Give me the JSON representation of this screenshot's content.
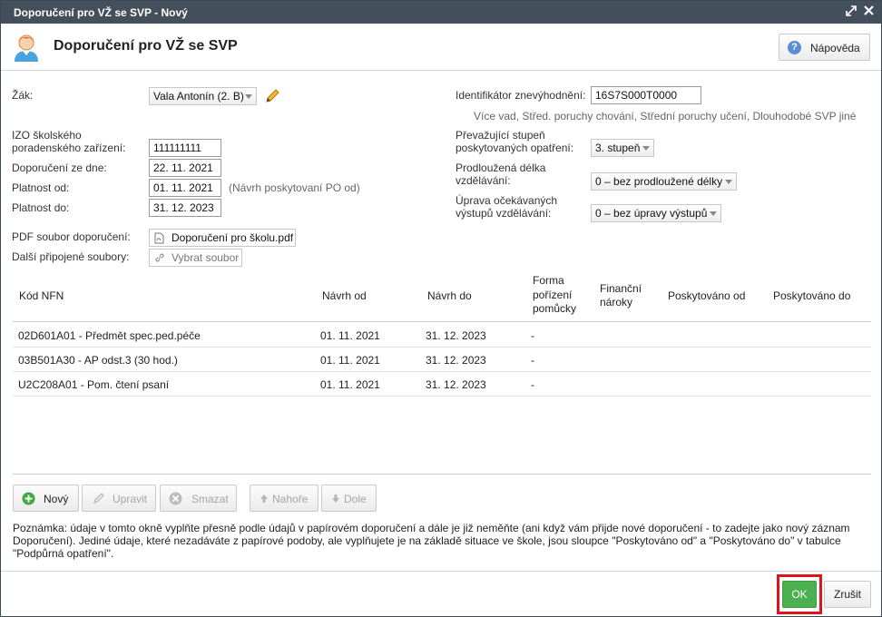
{
  "window": {
    "title": "Doporučení pro VŽ se SVP - Nový"
  },
  "header": {
    "title": "Doporučení pro VŽ se SVP",
    "help_label": "Nápověda"
  },
  "form": {
    "zak_label": "Žák:",
    "zak_value": "Vala Antonín (2. B)",
    "izo_label_1": "IZO školského",
    "izo_label_2": "poradenského zařízení:",
    "izo_value": "111111111",
    "doporuceni_label": "Doporučení ze dne:",
    "doporuceni_value": "22. 11. 2021",
    "platnost_od_label": "Platnost od:",
    "platnost_od_value": "01. 11. 2021",
    "platnost_od_note": "(Návrh poskytovaní PO od)",
    "platnost_do_label": "Platnost do:",
    "platnost_do_value": "31. 12. 2023",
    "pdf_label": "PDF soubor doporučení:",
    "pdf_value": "Doporučení pro školu.pdf",
    "dalsi_label": "Další připojené soubory:",
    "dalsi_value": "Vybrat soubor",
    "ident_label": "Identifikátor znevýhodnění:",
    "ident_value": "16S7S000T0000",
    "ident_desc": "Více vad, Střed. poruchy chování, Střední poruchy učení, Dlouhodobé SVP jiné",
    "stupen_label_1": "Převažující stupeň",
    "stupen_label_2": "poskytovaných opatření:",
    "stupen_value": "3. stupeň",
    "delka_label_1": "Prodloužená délka",
    "delka_label_2": "vzdělávání:",
    "delka_value": "0 – bez prodloužené délky",
    "uprava_label_1": "Úprava očekávaných",
    "uprava_label_2": "výstupů vzdělávání:",
    "uprava_value": "0 – bez úpravy výstupů"
  },
  "table": {
    "headers": {
      "kod": "Kód NFN",
      "navrh_od": "Návrh od",
      "navrh_do": "Návrh do",
      "forma_1": "Forma",
      "forma_2": "pořízení",
      "forma_3": "pomůcky",
      "financni_1": "Finanční",
      "financni_2": "nároky",
      "posk_od": "Poskytováno od",
      "posk_do": "Poskytováno do"
    },
    "rows": [
      {
        "kod": "02D601A01 - Předmět spec.ped.péče",
        "navrh_od": "01. 11. 2021",
        "navrh_do": "31. 12. 2023",
        "forma": "-"
      },
      {
        "kod": "03B501A30 - AP odst.3 (30 hod.)",
        "navrh_od": "01. 11. 2021",
        "navrh_do": "31. 12. 2023",
        "forma": "-"
      },
      {
        "kod": "U2C208A01 - Pom. čtení psaní",
        "navrh_od": "01. 11. 2021",
        "navrh_do": "31. 12. 2023",
        "forma": "-"
      }
    ]
  },
  "toolbar": {
    "novy": "Nový",
    "upravit": "Upravit",
    "smazat": "Smazat",
    "nahore": "Nahoře",
    "dole": "Dole"
  },
  "note": "Poznámka: údaje v tomto okně vyplňte přesně podle údajů v papírovém doporučení a dále je již neměňte (ani když vám přijde nové doporučení - to zadejte jako nový záznam Doporučení). Jediné údaje, které nezadáváte z papírové podoby, ale vyplňujete je na základě situace ve škole, jsou sloupce \"Poskytováno od\" a \"Poskytováno do\" v tabulce \"Podpůrná opatření\".",
  "footer": {
    "ok": "OK",
    "cancel": "Zrušit"
  },
  "colors": {
    "titlebar": "#43505c",
    "ok": "#4caf50",
    "highlight": "#e0141b",
    "help": "#5b8fd4"
  },
  "icons": [
    "user-avatar-icon",
    "question-icon",
    "pencil-icon",
    "pdf-file-icon",
    "link-icon",
    "plus-icon",
    "x-circle-icon",
    "arrow-up-icon",
    "arrow-down-icon",
    "expand-icon",
    "close-icon"
  ]
}
